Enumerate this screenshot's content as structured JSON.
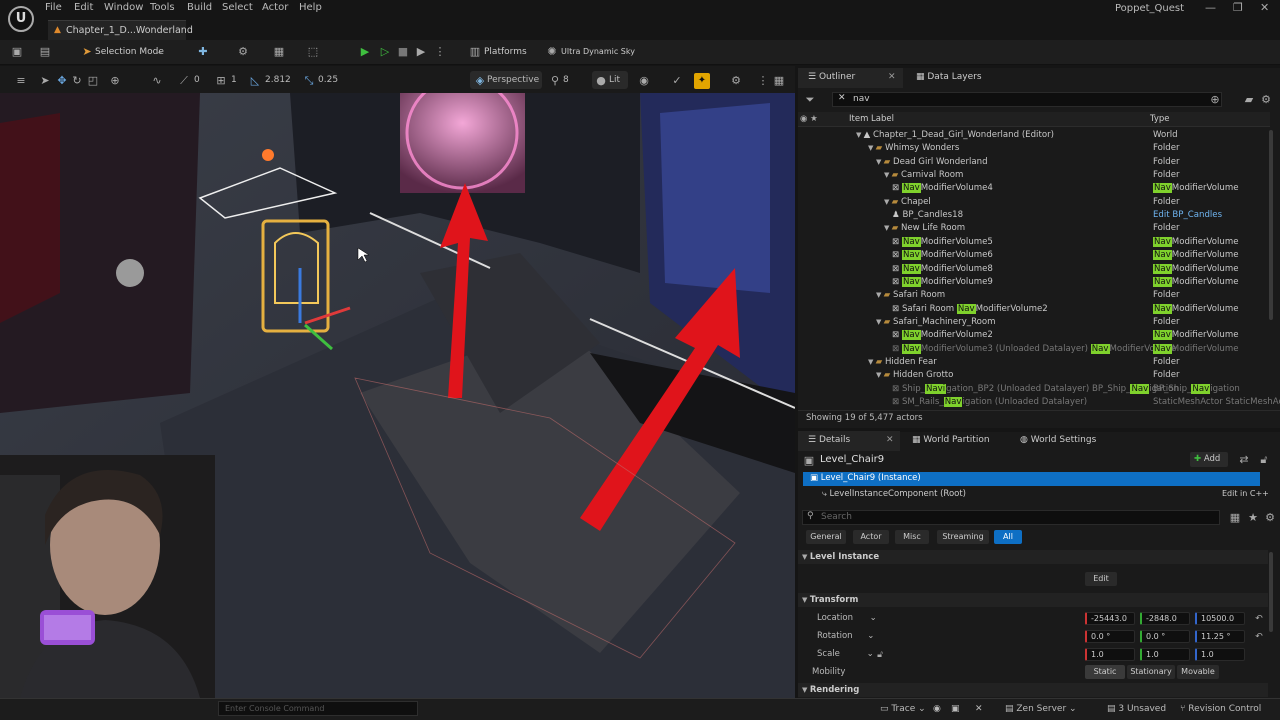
{
  "menu": [
    "File",
    "Edit",
    "Window",
    "Tools",
    "Build",
    "Select",
    "Actor",
    "Help"
  ],
  "doc_tab": "Chapter_1_D...Wonderland",
  "project": "Poppet_Quest",
  "toolbar": {
    "selection_mode": "Selection Mode",
    "platforms": "Platforms",
    "sky": "Ultra Dynamic Sky"
  },
  "viewport_bar": {
    "rot_snap": "0",
    "grid": "1",
    "scale_val": "2.812",
    "snap_val": "0.25",
    "view_mode": "Perspective",
    "speed": "8",
    "lit": "Lit"
  },
  "outliner": {
    "tab": "Outliner",
    "tab2": "Data Layers",
    "search_value": "nav",
    "col_label": "Item Label",
    "col_type": "Type",
    "rows": [
      {
        "label": "Chapter_1_Dead_Girl_Wonderland (Editor)",
        "type": "World",
        "indent": 56,
        "kind": "world"
      },
      {
        "label": "Whimsy Wonders",
        "type": "Folder",
        "indent": 68,
        "kind": "folder"
      },
      {
        "label": "Dead Girl Wonderland",
        "type": "Folder",
        "indent": 76,
        "kind": "folder"
      },
      {
        "label": "Carnival Room",
        "type": "Folder",
        "indent": 84,
        "kind": "folder"
      },
      {
        "pre": "",
        "hl": "Nav",
        "post": "ModifierVolume4",
        "type_hl": "Nav",
        "type_post": "ModifierVolume",
        "indent": 92,
        "kind": "nav"
      },
      {
        "label": "Chapel",
        "type": "Folder",
        "indent": 84,
        "kind": "folder"
      },
      {
        "label": "BP_Candles18",
        "type": "Edit BP_Candles",
        "indent": 92,
        "kind": "bp"
      },
      {
        "label": "New Life Room",
        "type": "Folder",
        "indent": 84,
        "kind": "folder"
      },
      {
        "pre": "",
        "hl": "Nav",
        "post": "ModifierVolume5",
        "type_hl": "Nav",
        "type_post": "ModifierVolume",
        "indent": 92,
        "kind": "nav"
      },
      {
        "pre": "",
        "hl": "Nav",
        "post": "ModifierVolume6",
        "type_hl": "Nav",
        "type_post": "ModifierVolume",
        "indent": 92,
        "kind": "nav"
      },
      {
        "pre": "",
        "hl": "Nav",
        "post": "ModifierVolume8",
        "type_hl": "Nav",
        "type_post": "ModifierVolume",
        "indent": 92,
        "kind": "nav"
      },
      {
        "pre": "",
        "hl": "Nav",
        "post": "ModifierVolume9",
        "type_hl": "Nav",
        "type_post": "ModifierVolume",
        "indent": 92,
        "kind": "nav"
      },
      {
        "label": "Safari Room",
        "type": "Folder",
        "indent": 76,
        "kind": "folder"
      },
      {
        "pre": "Safari Room ",
        "hl": "Nav",
        "post": "ModifierVolume2",
        "type_hl": "Nav",
        "type_post": "ModifierVolume",
        "indent": 92,
        "kind": "nav"
      },
      {
        "label": "Safari_Machinery_Room",
        "type": "Folder",
        "indent": 76,
        "kind": "folder"
      },
      {
        "pre": "",
        "hl": "Nav",
        "post": "ModifierVolume2",
        "type_hl": "Nav",
        "type_post": "ModifierVolume",
        "indent": 92,
        "kind": "nav"
      },
      {
        "pre": "",
        "hl": "Nav",
        "post": "ModifierVolume3 (Unloaded Datalayer) ",
        "hl2": "Nav",
        "post2": "ModifierVolume",
        "type_hl": "Nav",
        "type_post": "ModifierVolume",
        "indent": 92,
        "kind": "nav",
        "dim": true
      },
      {
        "label": "Hidden Fear",
        "type": "Folder",
        "indent": 68,
        "kind": "folder"
      },
      {
        "label": "Hidden Grotto",
        "type": "Folder",
        "indent": 76,
        "kind": "folder"
      },
      {
        "pre": "Ship_",
        "hl": "Navi",
        "post": "gation_BP2 (Unloaded Datalayer) BP_Ship_",
        "hl2": "Nav",
        "post2": "igation",
        "type_pre": "BP_Ship_",
        "type_hl": "Nav",
        "type_post": "igation",
        "indent": 92,
        "kind": "nav",
        "dim": true
      },
      {
        "pre": "SM_Rails_",
        "hl": "Nav",
        "post": "igation (Unloaded Datalayer)",
        "type": "StaticMeshActor StaticMeshActor",
        "indent": 92,
        "kind": "mesh",
        "dim": true
      }
    ],
    "status": "Showing 19 of 5,477 actors"
  },
  "details": {
    "tab": "Details",
    "tab2": "World Partition",
    "tab3": "World Settings",
    "actor_name": "Level_Chair9",
    "add_label": "Add",
    "instance": "Level_Chair9 (Instance)",
    "component": "LevelInstanceComponent (Root)",
    "edit_cpp": "Edit in C++",
    "search_placeholder": "Search",
    "filters": [
      "General",
      "Actor",
      "Misc",
      "Streaming",
      "All"
    ],
    "level_instance": "Level Instance",
    "edit_label": "Edit",
    "transform": "Transform",
    "location_label": "Location",
    "rotation_label": "Rotation",
    "scale_label": "Scale",
    "mobility_label": "Mobility",
    "location": [
      "-25443.0",
      "-2848.0",
      "10500.0"
    ],
    "rotation": [
      "0.0 °",
      "0.0 °",
      "11.25 °"
    ],
    "scale": [
      "1.0",
      "1.0",
      "1.0"
    ],
    "mobility": [
      "Static",
      "Stationary",
      "Movable"
    ],
    "rendering": "Rendering"
  },
  "statusbar": {
    "console_placeholder": "Enter Console Command",
    "trace": "Trace",
    "zen": "Zen Server",
    "unsaved": "3 Unsaved",
    "revision": "Revision Control"
  },
  "colors": {
    "accent": "#0e6fc4",
    "nav_highlight": "#7fd12c",
    "folder": "#b68a3c",
    "arrow_red": "#e0141b"
  }
}
